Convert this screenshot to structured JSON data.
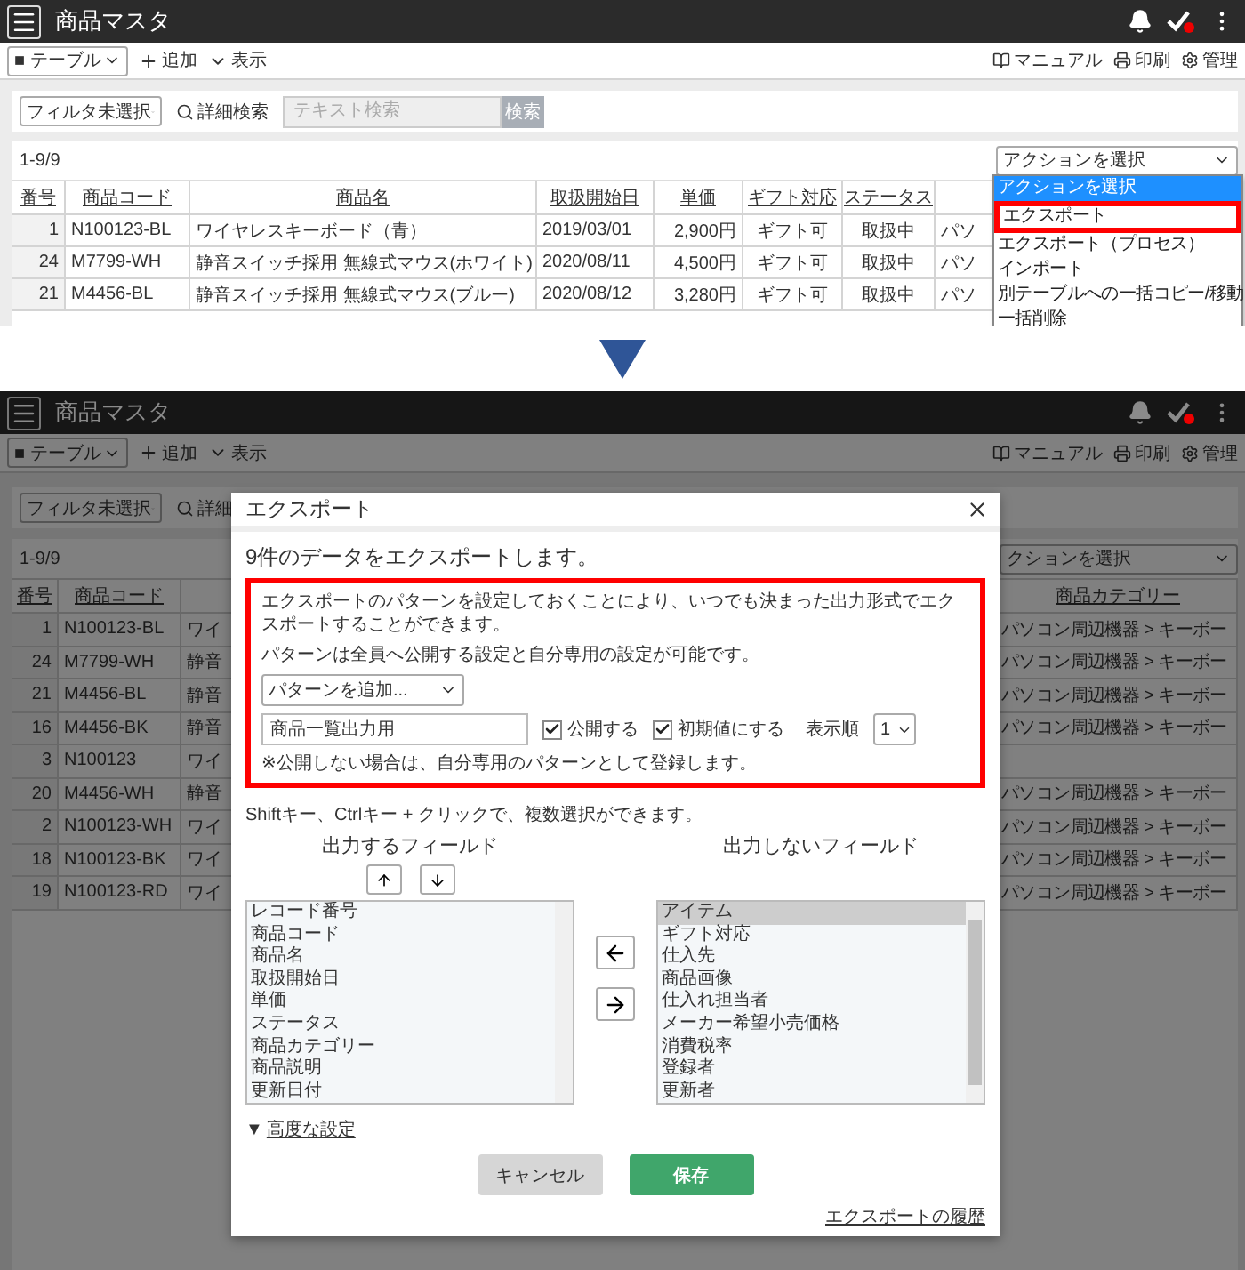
{
  "top": {
    "header": {
      "title": "商品マスタ"
    },
    "toolbar": {
      "view_select": "■ テーブル",
      "add": "追加",
      "display": "表示",
      "links": [
        {
          "kind": "manual",
          "label": "マニュアル"
        },
        {
          "kind": "print",
          "label": "印刷"
        },
        {
          "kind": "admin",
          "label": "管理"
        }
      ]
    },
    "filter": {
      "select": "フィルタ未選択",
      "detail_search": "詳細検索",
      "search_placeholder": "テキスト検索",
      "search_button": "検索"
    },
    "count": "1-9/9",
    "action_menu": {
      "value": "アクションを選択",
      "options": [
        {
          "label": "アクションを選択",
          "selected": true,
          "marked": false
        },
        {
          "label": "エクスポート",
          "selected": false,
          "marked": true
        },
        {
          "label": "エクスポート（プロセス）",
          "selected": false,
          "marked": false
        },
        {
          "label": "インポート",
          "selected": false,
          "marked": false
        },
        {
          "label": "別テーブルへの一括コピー/移動",
          "selected": false,
          "marked": false
        },
        {
          "label": "一括削除",
          "selected": false,
          "marked": false
        }
      ]
    },
    "table": {
      "columns": [
        "番号",
        "商品コード",
        "商品名",
        "取扱開始日",
        "単価",
        "ギフト対応",
        "ステータス"
      ],
      "rows": [
        [
          "1",
          "N100123-BL",
          "ワイヤレスキーボード（青）",
          "2019/03/01",
          "2,900円",
          "ギフト可",
          "取扱中",
          "パソ"
        ],
        [
          "24",
          "M7799-WH",
          "静音スイッチ採用 無線式マウス(ホワイト)",
          "2020/08/11",
          "4,500円",
          "ギフト可",
          "取扱中",
          "パソ"
        ],
        [
          "21",
          "M4456-BL",
          "静音スイッチ採用 無線式マウス(ブルー)",
          "2020/08/12",
          "3,280円",
          "ギフト可",
          "取扱中",
          "パソ"
        ]
      ]
    }
  },
  "bottom": {
    "header": {
      "title": "商品マスタ"
    },
    "toolbar": {
      "view_select": "■ テーブル",
      "add": "追加",
      "display": "表示",
      "links": [
        {
          "kind": "manual",
          "label": "マニュアル"
        },
        {
          "kind": "print",
          "label": "印刷"
        },
        {
          "kind": "admin",
          "label": "管理"
        }
      ]
    },
    "filter": {
      "select": "フィルタ未選択",
      "detail_search": "詳細"
    },
    "count": "1-9/9",
    "action_select": "クションを選択",
    "table": {
      "columns": [
        "番号",
        "商品コード"
      ],
      "category_column": "商品カテゴリー",
      "rows": [
        {
          "number": "1",
          "code": "N100123-BL",
          "name": "ワイ",
          "category": "パソコン周辺機器 > キーボー"
        },
        {
          "number": "24",
          "code": "M7799-WH",
          "name": "静音",
          "category": "パソコン周辺機器 > キーボー"
        },
        {
          "number": "21",
          "code": "M4456-BL",
          "name": "静音",
          "category": "パソコン周辺機器 > キーボー"
        },
        {
          "number": "16",
          "code": "M4456-BK",
          "name": "静音",
          "category": "パソコン周辺機器 > キーボー"
        },
        {
          "number": "3",
          "code": "N100123",
          "name": "ワイ"
        },
        {
          "number": "20",
          "code": "M4456-WH",
          "name": "静音",
          "category": "パソコン周辺機器 > キーボー"
        },
        {
          "number": "2",
          "code": "N100123-WH",
          "name": "ワイ",
          "category": "パソコン周辺機器 > キーボー"
        },
        {
          "number": "18",
          "code": "N100123-BK",
          "name": "ワイ",
          "category": "パソコン周辺機器 > キーボー"
        },
        {
          "number": "19",
          "code": "N100123-RD",
          "name": "ワイ",
          "category": "パソコン周辺機器 > キーボー"
        }
      ]
    },
    "modal": {
      "title": "エクスポート",
      "intro": "9件のデータをエクスポートします。",
      "pattern_panel": {
        "highlighted": true,
        "description": [
          "エクスポートのパターンを設定しておくことにより、いつでも決まった出力形式でエクスポートすることができます。",
          "パターンは全員へ公開する設定と自分専用の設定が可能です。"
        ],
        "pattern_select": "パターンを追加...",
        "name_value": "商品一覧出力用",
        "options": [
          {
            "label": "公開する",
            "checked": true
          },
          {
            "label": "初期値にする",
            "checked": true
          }
        ],
        "order_label": "表示順",
        "order_value": "1",
        "note": "※公開しない場合は、自分専用のパターンとして登録します。"
      },
      "hint": "Shiftキー、Ctrlキー + クリックで、複数選択ができます。",
      "output_fields": {
        "title": "出力するフィールド",
        "items": [
          {
            "label": "レコード番号",
            "selected": false
          },
          {
            "label": "商品コード",
            "selected": false
          },
          {
            "label": "商品名",
            "selected": false
          },
          {
            "label": "取扱開始日",
            "selected": false
          },
          {
            "label": "単価",
            "selected": false
          },
          {
            "label": "ステータス",
            "selected": false
          },
          {
            "label": "商品カテゴリー",
            "selected": false
          },
          {
            "label": "商品説明",
            "selected": false
          },
          {
            "label": "更新日付",
            "selected": false
          }
        ]
      },
      "excluded_fields": {
        "title": "出力しないフィールド",
        "items": [
          {
            "label": "アイテム",
            "selected": true
          },
          {
            "label": "ギフト対応",
            "selected": false
          },
          {
            "label": "仕入先",
            "selected": false
          },
          {
            "label": "商品画像",
            "selected": false
          },
          {
            "label": "仕入れ担当者",
            "selected": false
          },
          {
            "label": "メーカー希望小売価格",
            "selected": false
          },
          {
            "label": "消費税率",
            "selected": false
          },
          {
            "label": "登録者",
            "selected": false
          },
          {
            "label": "更新者",
            "selected": false
          }
        ]
      },
      "advanced": {
        "marker": "▼",
        "label": "高度な設定"
      },
      "buttons": {
        "cancel": "キャンセル",
        "save": "保存"
      },
      "history_link": "エクスポートの履歴"
    }
  }
}
